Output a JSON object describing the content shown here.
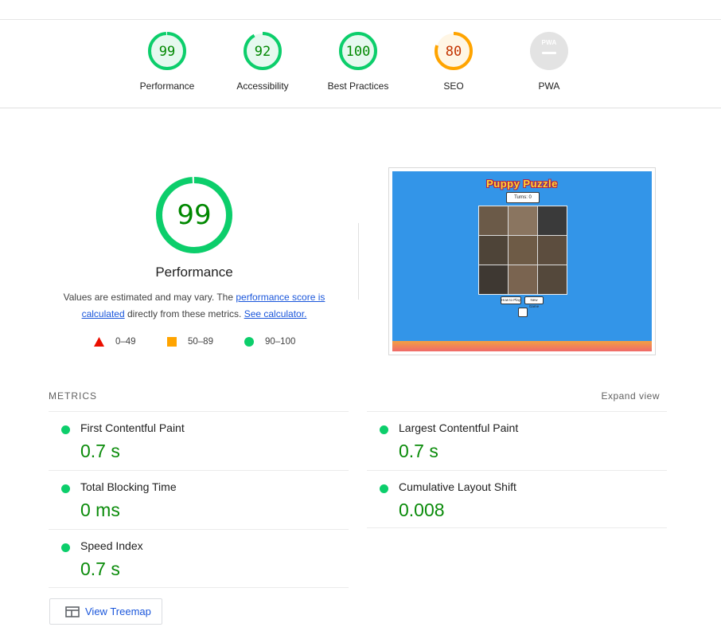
{
  "categories": [
    {
      "label": "Performance",
      "score": "99",
      "value": 0.99,
      "color": "#0cce6b",
      "bg": "#e6f9ef",
      "text_color": "#008800"
    },
    {
      "label": "Accessibility",
      "score": "92",
      "value": 0.92,
      "color": "#0cce6b",
      "bg": "#e6f9ef",
      "text_color": "#008800"
    },
    {
      "label": "Best Practices",
      "score": "100",
      "value": 1.0,
      "color": "#0cce6b",
      "bg": "#e6f9ef",
      "text_color": "#008800"
    },
    {
      "label": "SEO",
      "score": "80",
      "value": 0.8,
      "color": "#ffa400",
      "bg": "#fff6e5",
      "text_color": "#c33300"
    },
    {
      "label": "PWA",
      "badge": "PWA"
    }
  ],
  "performance": {
    "score": "99",
    "value": 0.99,
    "title": "Performance",
    "desc_prefix": "Values are estimated and may vary. The ",
    "desc_link1": "performance score is calculated",
    "desc_middle": " directly from these metrics. ",
    "desc_link2": "See calculator."
  },
  "legend": [
    {
      "range": "0–49",
      "color": "#eb0f00",
      "shape": "triangle"
    },
    {
      "range": "50–89",
      "color": "#ffa400",
      "shape": "square"
    },
    {
      "range": "90–100",
      "color": "#0cce6b",
      "shape": "circle"
    }
  ],
  "screenshot": {
    "app_title": "Puppy Puzzle",
    "turns_label": "Turns: 0",
    "btn_how": "How to Play",
    "btn_new": "New Game"
  },
  "metrics": {
    "header": "METRICS",
    "expand": "Expand view",
    "items": [
      {
        "label": "First Contentful Paint",
        "value": "0.7 s"
      },
      {
        "label": "Largest Contentful Paint",
        "value": "0.7 s"
      },
      {
        "label": "Total Blocking Time",
        "value": "0 ms"
      },
      {
        "label": "Cumulative Layout Shift",
        "value": "0.008"
      },
      {
        "label": "Speed Index",
        "value": "0.7 s"
      }
    ]
  },
  "treemap": {
    "label": "View Treemap"
  },
  "colors": {
    "pass": "#0cce6b",
    "average": "#ffa400",
    "fail": "#eb0f00",
    "link": "#1a56db"
  }
}
